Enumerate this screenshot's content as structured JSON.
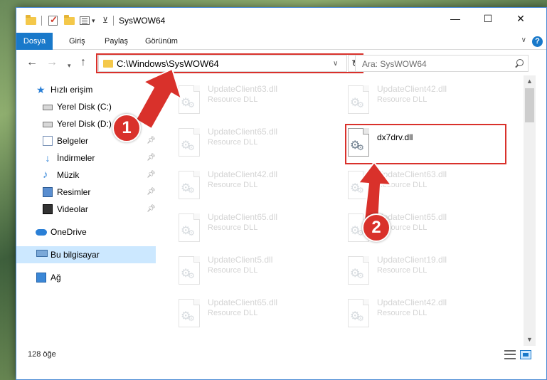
{
  "window": {
    "title": "SysWOW64",
    "minimize_glyph": "—",
    "maximize_glyph": "☐",
    "close_glyph": "✕"
  },
  "ribbon": {
    "tabs": [
      {
        "label": "Dosya"
      },
      {
        "label": "Giriş"
      },
      {
        "label": "Paylaş"
      },
      {
        "label": "Görünüm"
      }
    ],
    "help_label": "?"
  },
  "address": {
    "path": "C:\\Windows\\SysWOW64",
    "search_placeholder": "Ara: SysWOW64"
  },
  "sidebar": {
    "items": [
      {
        "label": "Hızlı erişim",
        "icon": "star-icon",
        "pinned": false
      },
      {
        "label": "Yerel Disk (C:)",
        "icon": "disk-icon",
        "pinned": true
      },
      {
        "label": "Yerel Disk (D:)",
        "icon": "disk-icon",
        "pinned": true
      },
      {
        "label": "Belgeler",
        "icon": "documents-icon",
        "pinned": true
      },
      {
        "label": "İndirmeler",
        "icon": "download-icon",
        "pinned": true
      },
      {
        "label": "Müzik",
        "icon": "music-icon",
        "pinned": true
      },
      {
        "label": "Resimler",
        "icon": "pictures-icon",
        "pinned": true
      },
      {
        "label": "Videolar",
        "icon": "videos-icon",
        "pinned": true
      },
      {
        "label": "OneDrive",
        "icon": "cloud-icon",
        "pinned": false
      },
      {
        "label": "Bu bilgisayar",
        "icon": "computer-icon",
        "pinned": false,
        "selected": true
      },
      {
        "label": "Ağ",
        "icon": "network-icon",
        "pinned": false
      }
    ]
  },
  "files": [
    {
      "name": "UpdateClient63.dll",
      "type": "Resource DLL",
      "faded": true
    },
    {
      "name": "UpdateClient42.dll",
      "type": "Resource DLL",
      "faded": true
    },
    {
      "name": "UpdateClient65.dll",
      "type": "Resource DLL",
      "faded": true
    },
    {
      "name": "dx7drv.dll",
      "type": "",
      "faded": false
    },
    {
      "name": "UpdateClient42.dll",
      "type": "Resource DLL",
      "faded": true
    },
    {
      "name": "UpdateClient63.dll",
      "type": "Resource DLL",
      "faded": true
    },
    {
      "name": "UpdateClient65.dll",
      "type": "Resource DLL",
      "faded": true
    },
    {
      "name": "UpdateClient65.dll",
      "type": "Resource DLL",
      "faded": true
    },
    {
      "name": "UpdateClient5.dll",
      "type": "Resource DLL",
      "faded": true
    },
    {
      "name": "UpdateClient19.dll",
      "type": "Resource DLL",
      "faded": true
    },
    {
      "name": "UpdateClient65.dll",
      "type": "Resource DLL",
      "faded": true
    },
    {
      "name": "UpdateClient42.dll",
      "type": "Resource DLL",
      "faded": true
    }
  ],
  "status": {
    "item_count": "128 öğe"
  },
  "annotations": {
    "step1": "1",
    "step2": "2",
    "highlight_color": "#d9312b"
  },
  "colors": {
    "accent": "#1979ca",
    "selection": "#cce8ff"
  }
}
